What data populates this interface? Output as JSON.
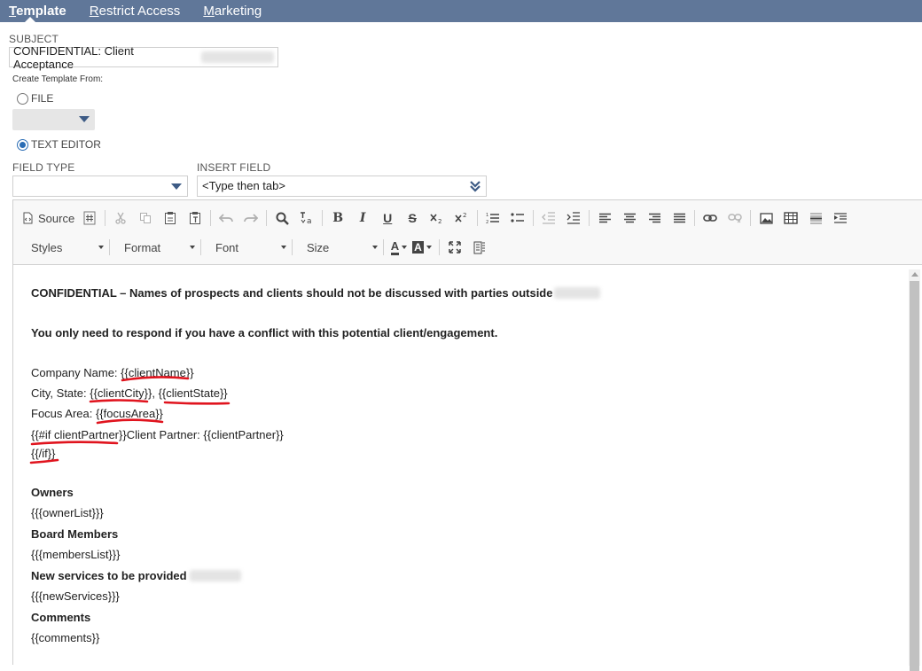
{
  "tabs": [
    {
      "first": "T",
      "rest": "emplate"
    },
    {
      "first": "R",
      "rest": "estrict Access"
    },
    {
      "first": "M",
      "rest": "arketing"
    }
  ],
  "subject": {
    "label": "SUBJECT",
    "value": "CONFIDENTIAL: Client Acceptance"
  },
  "create_template": {
    "label": "Create Template From:",
    "file_label": "FILE",
    "text_editor_label": "TEXT EDITOR",
    "selected": "TEXT EDITOR"
  },
  "field_type": {
    "label": "FIELD TYPE",
    "value": ""
  },
  "insert_field": {
    "label": "INSERT FIELD",
    "value": "<Type then tab>"
  },
  "toolbar": {
    "source_label": "Source",
    "styles_label": "Styles",
    "format_label": "Format",
    "font_label": "Font",
    "size_label": "Size",
    "bold": "B",
    "italic": "I",
    "underline": "U",
    "strike": "S",
    "text_color": "A",
    "bg_color": "A"
  },
  "body": {
    "line1": "CONFIDENTIAL – Names of prospects and clients should not be discussed with parties outside",
    "line2": "You only need to respond if you have a conflict with this potential client/engagement.",
    "company_prefix": "Company Name: ",
    "company_token": "{{clientName}}",
    "city_prefix": "City, State: ",
    "city_token": "{{clientCity}}",
    "city_sep": ", ",
    "state_token": "{{clientState}}",
    "focus_prefix": "Focus Area: ",
    "focus_token": "{{focusArea}}",
    "if_token": "{{#if clientPartner}}",
    "partner_text": "Client Partner: {{clientPartner}}",
    "endif_token": "{{/if}}",
    "owners_heading": "Owners",
    "owners_token": "{{{ownerList}}}",
    "board_heading": "Board Members",
    "board_token": "{{{membersList}}}",
    "services_heading": "New services to be provided",
    "services_token": "{{{newServices}}}",
    "comments_heading": "Comments",
    "comments_token": "{{comments}}"
  },
  "colors": {
    "tabbar": "#607799",
    "annotation": "#e0141e",
    "accent": "#2a6db5"
  }
}
